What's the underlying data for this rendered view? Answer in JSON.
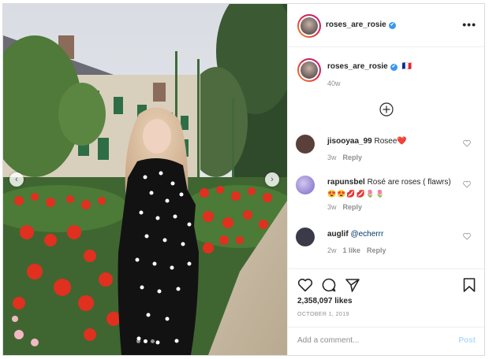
{
  "post": {
    "username": "roses_are_rosie",
    "caption_username": "roses_are_rosie",
    "caption_flag": "🇫🇷",
    "caption_time": "40w",
    "likes": "2,358,097 likes",
    "date": "OCTOBER 1, 2019",
    "more_icon": "•••"
  },
  "comments": [
    {
      "user": "jisooyaa_99",
      "text": "Rosee",
      "emoji": "❤️",
      "time": "3w",
      "reply": "Reply",
      "likes": "",
      "avatar_color": "#5a3f3a"
    },
    {
      "user": "rapunsbel",
      "text": "Rosé are roses ( flawrs)",
      "emoji": "😍😍💋💋🌷🌷",
      "time": "3w",
      "reply": "Reply",
      "likes": "",
      "avatar_color": "#8f7ccf"
    },
    {
      "user": "auglif",
      "text": "@echerrr",
      "emoji": "",
      "time": "2w",
      "reply": "Reply",
      "likes": "1 like",
      "avatar_color": "#3a3a48"
    }
  ],
  "add_comment": {
    "placeholder": "Add a comment...",
    "post_label": "Post"
  },
  "icons": {
    "verified": "✔",
    "nav_left": "‹",
    "nav_right": "›"
  },
  "colors": {
    "verified_blue": "#3897f0",
    "post_disabled": "#b3dbff",
    "muted": "#8e8e8e"
  }
}
